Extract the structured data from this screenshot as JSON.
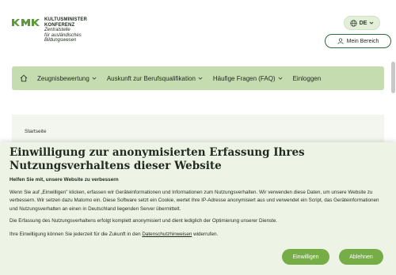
{
  "logo": {
    "line1": "KULTUSMINISTER",
    "line2": "KONFERENZ",
    "line3": "Zentralstelle",
    "line4": "für ausländisches",
    "line5": "Bildungswesen"
  },
  "header": {
    "language": "DE",
    "login_label": "Mein Bereich"
  },
  "nav": {
    "items": [
      {
        "label": "Zeugnisbewertung",
        "has_dropdown": true
      },
      {
        "label": "Auskunft zur Berufsqualifikation",
        "has_dropdown": true
      },
      {
        "label": "Häufige Fragen (FAQ)",
        "has_dropdown": true
      },
      {
        "label": "Einloggen",
        "has_dropdown": false
      }
    ]
  },
  "breadcrumb": {
    "home": "Startseite"
  },
  "consent": {
    "title": "Einwilligung zur anonymisierten Erfassung Ihres Nutzungsverhaltens dieser Website",
    "subtitle": "Helfen Sie mit, unsere Website zu verbessern",
    "paragraph1": "Wenn Sie auf „Einwilligen\" klicken, erfassen wir Geräteinformationen und Informationen zum Nutzungsverhalten. Wir verwenden diese Daten, um unsere Website zu verbessern. Wir setzen dazu Matomo ein. Diese Software setzt ein Cookie, wertet Ihre IP-Adresse anonymisiert aus und verwendet ein Script, das Geräteinformationen und Nutzungsverhalten an einen in Deutschland liegenden Server übermittelt.",
    "paragraph2": "Die Erfassung des Nutzungsverhaltens erfolgt komplett anonymisiert und dient lediglich der Optimierung unserer Dienste.",
    "paragraph3_prefix": "Ihre Einwilligung können Sie jederzeit für die Zukunft in den ",
    "paragraph3_link": "Datenschutzhinweisen",
    "paragraph3_suffix": " widerrufen.",
    "accept_label": "Einwilligen",
    "reject_label": "Ablehnen"
  },
  "colors": {
    "brand_green": "#5a9a3a",
    "nav_bg": "#c4dcaf",
    "consent_bg": "#edf4e5",
    "button_green": "#76ad47"
  }
}
